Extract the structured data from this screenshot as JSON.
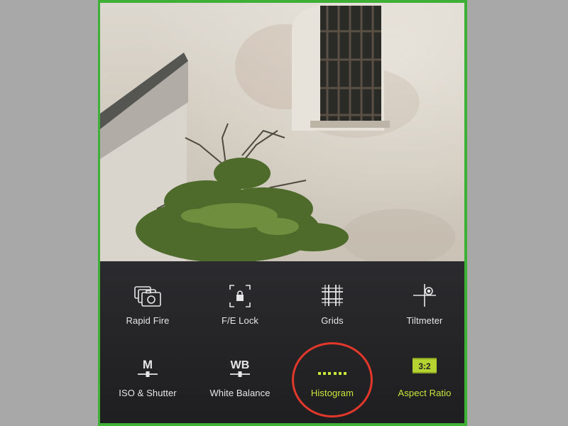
{
  "tools": [
    {
      "id": "rapid-fire",
      "label": "Rapid Fire",
      "icon": "camera-stack-icon",
      "active": false
    },
    {
      "id": "fe-lock",
      "label": "F/E Lock",
      "icon": "focus-lock-icon",
      "active": false
    },
    {
      "id": "grids",
      "label": "Grids",
      "icon": "grid-icon",
      "active": false
    },
    {
      "id": "tiltmeter",
      "label": "Tiltmeter",
      "icon": "crosshair-icon",
      "active": false
    },
    {
      "id": "iso-shutter",
      "label": "ISO & Shutter",
      "icon": "manual-slider-icon",
      "icon_text": "M",
      "active": false
    },
    {
      "id": "white-balance",
      "label": "White Balance",
      "icon": "white-balance-slider-icon",
      "icon_text": "WB",
      "active": false
    },
    {
      "id": "histogram",
      "label": "Histogram",
      "icon": "histogram-dots-icon",
      "active": true
    },
    {
      "id": "aspect-ratio",
      "label": "Aspect Ratio",
      "icon": "aspect-ratio-icon",
      "icon_text": "3:2",
      "active": true
    }
  ],
  "colors": {
    "active_accent": "#c7e63c",
    "highlight_circle": "#e2372b",
    "frame_border": "#3fb036",
    "label_text": "#e6e6e6"
  }
}
